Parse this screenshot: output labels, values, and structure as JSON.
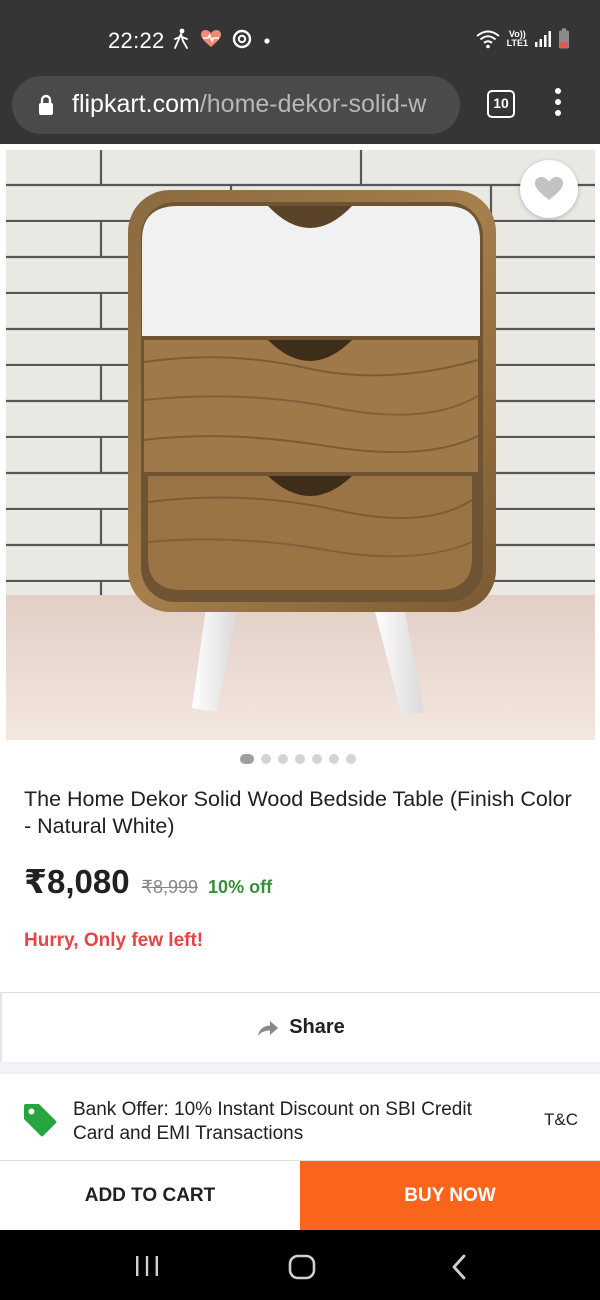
{
  "status_bar": {
    "time": "22:22",
    "left_icons": [
      "walking-icon",
      "heart-rate-icon",
      "fitness-ring-icon",
      "dot-icon"
    ],
    "right_icons": [
      "wifi-icon",
      "volte-icon",
      "signal-icon",
      "battery-icon"
    ],
    "volte_text_top": "Vo))",
    "volte_text_bottom": "LTE1"
  },
  "browser": {
    "url_domain": "flipkart.com",
    "url_path": "/home-dekor-solid-w",
    "tabs_count": "10"
  },
  "product": {
    "image_description_icon": "bedside-table-photo",
    "carousel": {
      "total": 7,
      "active": 0
    },
    "title": "The Home Dekor Solid Wood Bedside Table (Finish Color - Natural White)",
    "price": "₹8,080",
    "mrp": "₹8,999",
    "discount": "10% off",
    "stock_message": "Hurry, Only few left!"
  },
  "share": {
    "label": "Share"
  },
  "offer": {
    "text": "Bank Offer: 10% Instant Discount on SBI Credit Card and EMI Transactions",
    "tnc": "T&C"
  },
  "actions": {
    "add_to_cart": "ADD TO CART",
    "buy_now": "BUY NOW"
  },
  "nav": {
    "items": [
      "recent-apps-icon",
      "home-icon",
      "back-icon"
    ]
  },
  "colors": {
    "buy_now": "#fb641b",
    "discount": "#388e3c",
    "stock": "#e54545",
    "offer_tag": "#26a541",
    "status_bg": "#353535"
  }
}
